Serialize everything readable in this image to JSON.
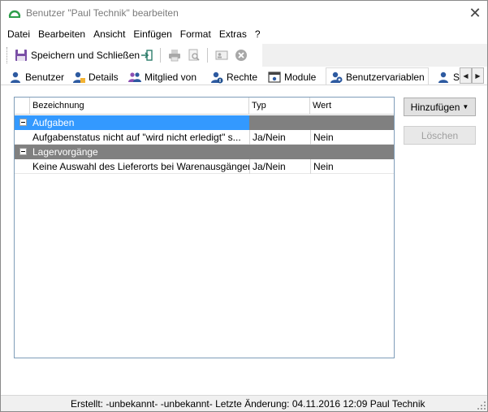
{
  "window": {
    "title": "Benutzer \"Paul Technik\" bearbeiten",
    "close_glyph": "✕"
  },
  "menu": {
    "items": [
      "Datei",
      "Bearbeiten",
      "Ansicht",
      "Einfügen",
      "Format",
      "Extras",
      "?"
    ]
  },
  "toolbar": {
    "save_label": "Speichern und Schließen",
    "icons": [
      "save-icon",
      "exit-icon",
      "print-icon",
      "print-preview-icon",
      "contact-card-icon",
      "cancel-icon"
    ]
  },
  "tabs": [
    {
      "label": "Benutzer",
      "icon": "user-icon"
    },
    {
      "label": "Details",
      "icon": "user-details-icon"
    },
    {
      "label": "Mitglied von",
      "icon": "group-icon"
    },
    {
      "label": "Rechte",
      "icon": "user-rights-icon"
    },
    {
      "label": "Module",
      "icon": "module-icon"
    },
    {
      "label": "Benutzervariablen",
      "icon": "user-variables-icon",
      "active": true
    },
    {
      "label": "St",
      "icon": "user-icon"
    }
  ],
  "grid": {
    "columns": [
      "Bezeichnung",
      "Typ",
      "Wert"
    ],
    "groups": [
      {
        "name": "Aufgaben",
        "selected": true,
        "rows": [
          {
            "bezeichnung": "Aufgabenstatus nicht auf \"wird nicht erledigt\" s...",
            "typ": "Ja/Nein",
            "wert": "Nein"
          }
        ]
      },
      {
        "name": "Lagervorgänge",
        "selected": false,
        "rows": [
          {
            "bezeichnung": "Keine Auswahl des Lieferorts bei Warenausgängen",
            "typ": "Ja/Nein",
            "wert": "Nein"
          }
        ]
      }
    ]
  },
  "buttons": {
    "add_label": "Hinzufügen",
    "delete_label": "Löschen"
  },
  "status": {
    "text": "Erstellt: -unbekannt- -unbekannt-  Letzte Änderung: 04.11.2016 12:09 Paul Technik"
  },
  "colors": {
    "selection": "#3399ff",
    "group_header": "#808080",
    "accent_green": "#2e9e4b"
  }
}
